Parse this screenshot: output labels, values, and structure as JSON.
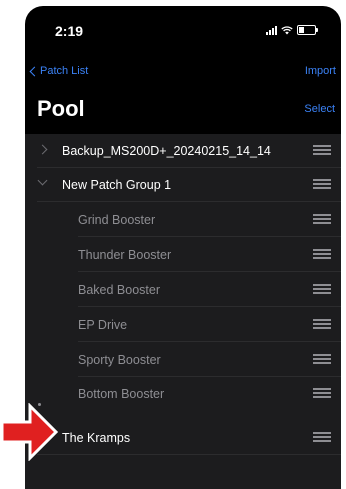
{
  "status_bar": {
    "time": "2:19"
  },
  "nav": {
    "back_label": "Patch List",
    "import_label": "Import"
  },
  "header": {
    "title": "Pool",
    "select_label": "Select"
  },
  "list": {
    "rows": [
      {
        "label": "Backup_MS200D+_20240215_14_14",
        "state": "collapsed"
      },
      {
        "label": "New Patch Group 1",
        "state": "expanded"
      },
      {
        "label": "Grind Booster"
      },
      {
        "label": "Thunder Booster"
      },
      {
        "label": "Baked Booster"
      },
      {
        "label": "EP Drive"
      },
      {
        "label": "Sporty Booster"
      },
      {
        "label": "Bottom Booster"
      },
      {
        "label": "The Kramps"
      }
    ]
  },
  "colors": {
    "background": "#000000",
    "list_background": "#1c1c1e",
    "accent": "#3b82f6",
    "text_primary": "#ffffff",
    "text_secondary": "#8e8e93",
    "arrow_red": "#e02020"
  }
}
